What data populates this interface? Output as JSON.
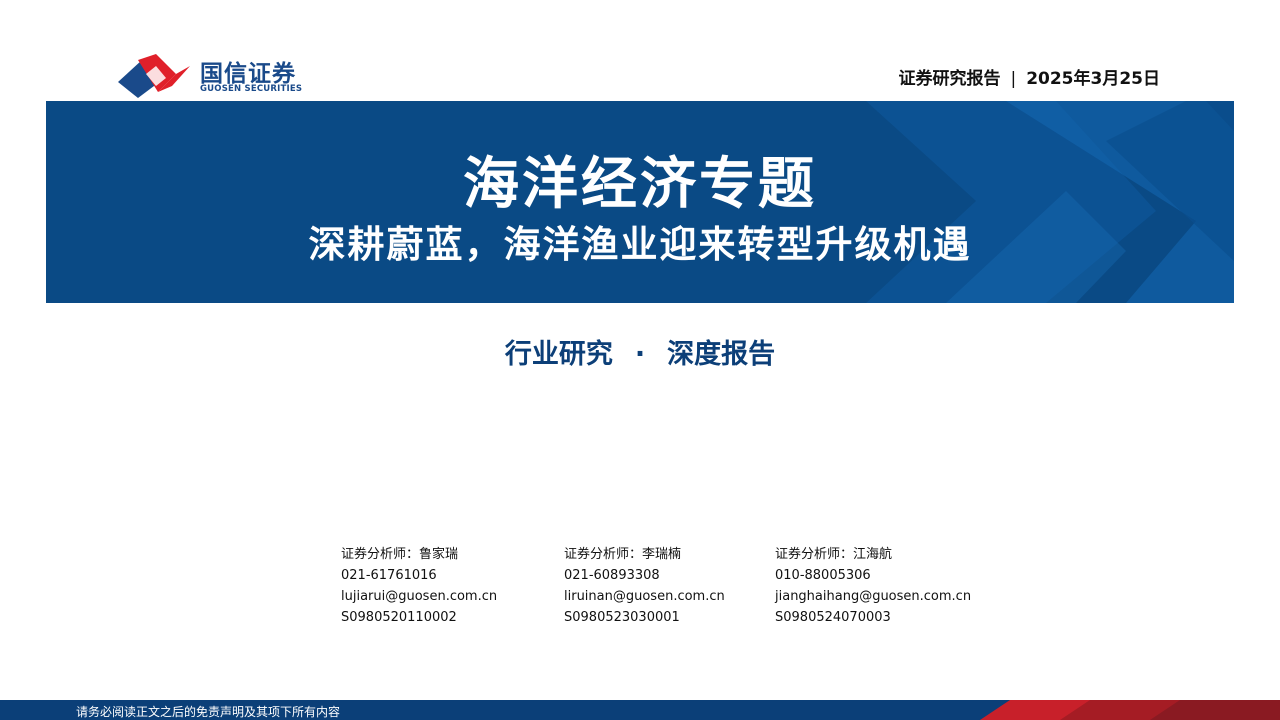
{
  "brand": {
    "name_cn": "国信证券",
    "name_en": "GUOSEN SECURITIES",
    "colors": {
      "blue": "#1a4a8a",
      "red": "#e0202a"
    }
  },
  "header": {
    "report_label": "证券研究报告",
    "separator": "|",
    "date": "2025年3月25日"
  },
  "banner": {
    "title": "海洋经济专题",
    "subtitle": "深耕蔚蓝，海洋渔业迎来转型升级机遇",
    "background_color": "#0a4a85"
  },
  "report_type": {
    "category": "行业研究",
    "dot": "·",
    "kind": "深度报告"
  },
  "analysts": [
    {
      "title_name": "证券分析师：鲁家瑞",
      "phone": "021-61761016",
      "email": "lujiarui@guosen.com.cn",
      "license": "S0980520110002"
    },
    {
      "title_name": "证券分析师：李瑞楠",
      "phone": "021-60893308",
      "email": "liruinan@guosen.com.cn",
      "license": "S0980523030001"
    },
    {
      "title_name": "证券分析师：江海航",
      "phone": "010-88005306",
      "email": "jianghaihang@guosen.com.cn",
      "license": "S0980524070003"
    }
  ],
  "footer": {
    "disclaimer": "请务必阅读正文之后的免责声明及其项下所有内容"
  }
}
